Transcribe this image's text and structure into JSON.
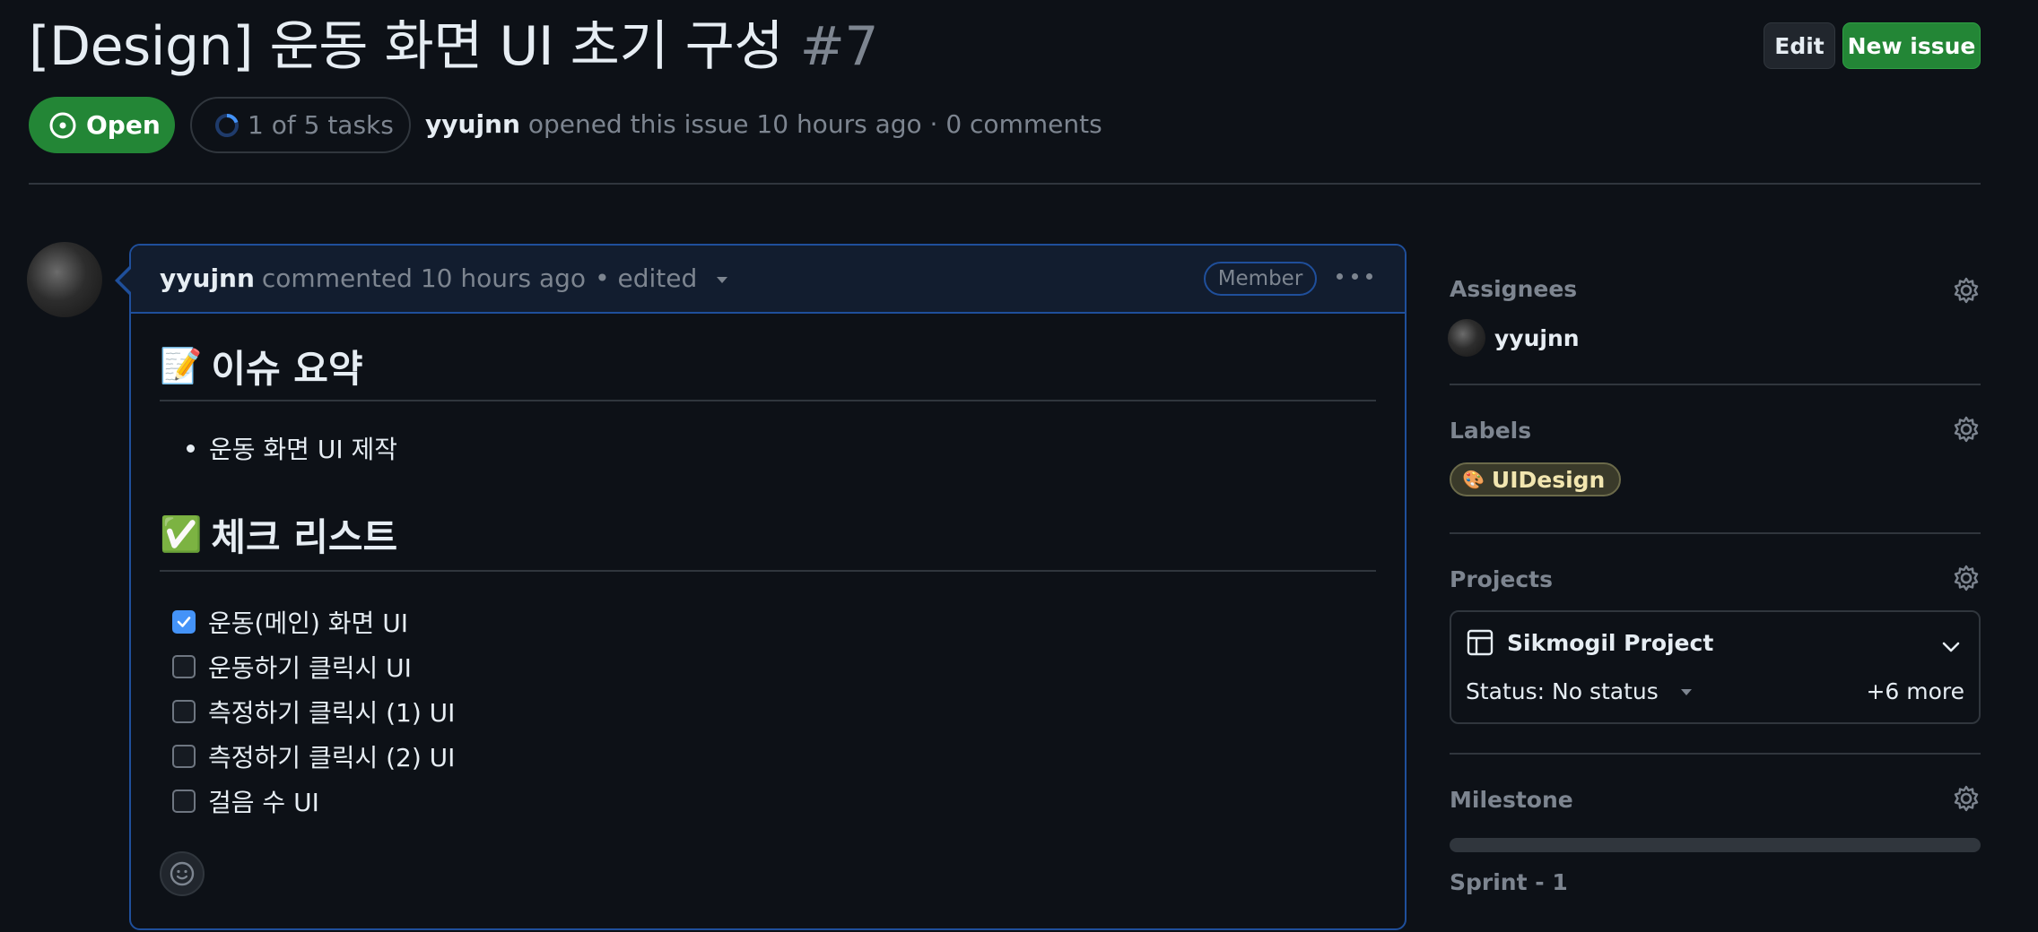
{
  "issue": {
    "title": "[Design] 운동 화면 UI 초기 구성",
    "number": "#7",
    "state_label": "Open",
    "tasks_label": "1 of 5 tasks",
    "author": "yyujnn",
    "opened_text": "opened this issue 10 hours ago · 0 comments"
  },
  "header": {
    "edit_label": "Edit",
    "new_issue_label": "New issue"
  },
  "comment": {
    "author": "yyujnn",
    "commented_text": "commented 10 hours ago",
    "edited_text": "• edited",
    "role_badge": "Member",
    "summary_emoji": "📝",
    "summary_heading": "이슈 요약",
    "summary_items": [
      "운동 화면 UI 제작"
    ],
    "checklist_emoji": "✅",
    "checklist_heading": "체크 리스트",
    "tasks": [
      {
        "label": "운동(메인) 화면 UI",
        "checked": true
      },
      {
        "label": "운동하기 클릭시 UI",
        "checked": false
      },
      {
        "label": "측정하기 클릭시 (1) UI",
        "checked": false
      },
      {
        "label": "측정하기 클릭시 (2) UI",
        "checked": false
      },
      {
        "label": "걸음 수 UI",
        "checked": false
      }
    ]
  },
  "sidebar": {
    "assignees_heading": "Assignees",
    "assignee_name": "yyujnn",
    "labels_heading": "Labels",
    "label_emoji": "🎨",
    "label_name": "UIDesign",
    "projects_heading": "Projects",
    "project_name": "Sikmogil Project",
    "project_status": "Status: No status",
    "project_more": "+6 more",
    "milestone_heading": "Milestone",
    "milestone_name": "Sprint - 1",
    "milestone_progress": 0
  },
  "colors": {
    "background": "#0d1117",
    "open_green": "#238636",
    "accent_blue": "#1f4f9b",
    "checkbox_blue": "#4493f8",
    "muted": "#7d8590"
  }
}
